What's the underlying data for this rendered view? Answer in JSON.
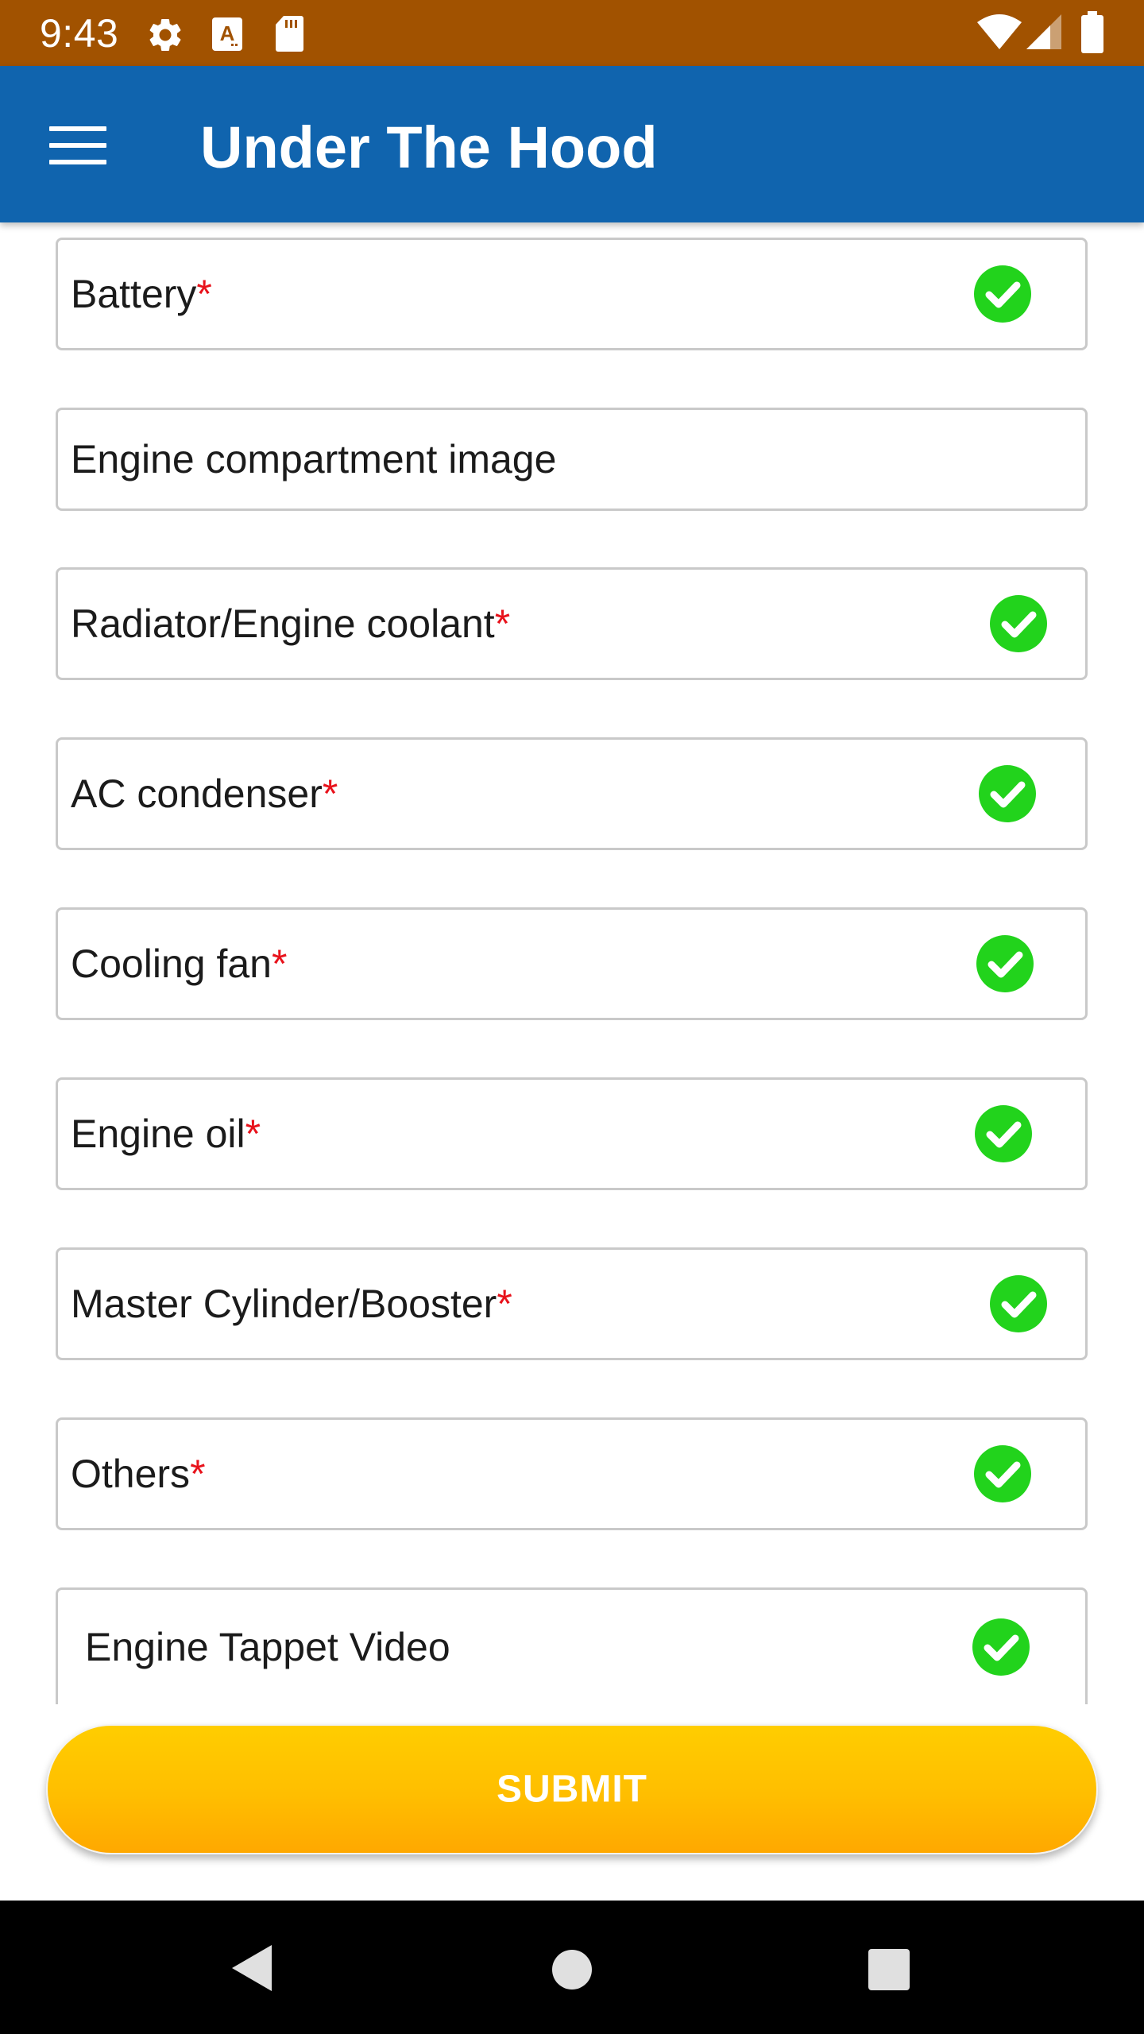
{
  "status_bar": {
    "time": "9:43",
    "left_icons": [
      "gear-icon",
      "font-a-icon",
      "sd-card-icon"
    ],
    "right_icons": [
      "wifi-icon",
      "signal-icon",
      "battery-icon"
    ]
  },
  "app_bar": {
    "menu_icon": "hamburger-menu-icon",
    "title": "Under The Hood"
  },
  "fields": [
    {
      "label": "Battery",
      "required": "*",
      "checked": true
    },
    {
      "label": "Engine compartment image",
      "required": "",
      "checked": false
    },
    {
      "label": "Radiator/Engine coolant",
      "required": "*",
      "checked": true
    },
    {
      "label": "AC condenser",
      "required": "*",
      "checked": true
    },
    {
      "label": "Cooling fan",
      "required": "*",
      "checked": true
    },
    {
      "label": "Engine oil",
      "required": "*",
      "checked": true
    },
    {
      "label": "Master Cylinder/Booster",
      "required": "*",
      "checked": true
    },
    {
      "label": "Others",
      "required": "*",
      "checked": true
    },
    {
      "label": "Engine Tappet Video",
      "required": "",
      "checked": true
    }
  ],
  "submit": {
    "label": "SUBMIT"
  },
  "nav_bar": {
    "icons": [
      "back-icon",
      "home-icon",
      "recents-icon"
    ]
  },
  "colors": {
    "status_bar": "#A15200",
    "app_bar": "#1064AE",
    "check": "#22D31C",
    "required": "#E8121B",
    "submit": "#FFBE00"
  }
}
